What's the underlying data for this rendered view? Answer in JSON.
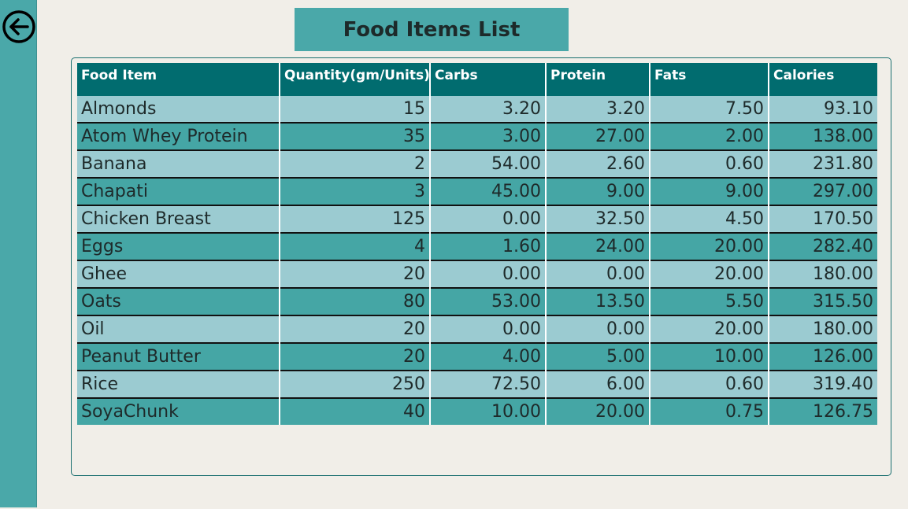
{
  "header": {
    "title": "Food Items List"
  },
  "nav": {
    "back_icon": "arrow-left-circle-icon"
  },
  "table": {
    "columns": [
      "Food Item",
      "Quantity(gm/Units)",
      "Carbs",
      "Protein",
      "Fats",
      "Calories"
    ],
    "rows": [
      [
        "Almonds",
        "15",
        "3.20",
        "3.20",
        "7.50",
        "93.10"
      ],
      [
        "Atom Whey Protein",
        "35",
        "3.00",
        "27.00",
        "2.00",
        "138.00"
      ],
      [
        "Banana",
        "2",
        "54.00",
        "2.60",
        "0.60",
        "231.80"
      ],
      [
        "Chapati",
        "3",
        "45.00",
        "9.00",
        "9.00",
        "297.00"
      ],
      [
        "Chicken Breast",
        "125",
        "0.00",
        "32.50",
        "4.50",
        "170.50"
      ],
      [
        "Eggs",
        "4",
        "1.60",
        "24.00",
        "20.00",
        "282.40"
      ],
      [
        "Ghee",
        "20",
        "0.00",
        "0.00",
        "20.00",
        "180.00"
      ],
      [
        "Oats",
        "80",
        "53.00",
        "13.50",
        "5.50",
        "315.50"
      ],
      [
        "Oil",
        "20",
        "0.00",
        "0.00",
        "20.00",
        "180.00"
      ],
      [
        "Peanut Butter",
        "20",
        "4.00",
        "5.00",
        "10.00",
        "126.00"
      ],
      [
        "Rice",
        "250",
        "72.50",
        "6.00",
        "0.60",
        "319.40"
      ],
      [
        "SoyaChunk",
        "40",
        "10.00",
        "20.00",
        "0.75",
        "126.75"
      ]
    ]
  },
  "colors": {
    "rail": "#4aa8a9",
    "header_bg": "#016c6f",
    "row_light": "#9bcbd1",
    "row_dark": "#45a6a5",
    "page_bg": "#f1eee8"
  }
}
